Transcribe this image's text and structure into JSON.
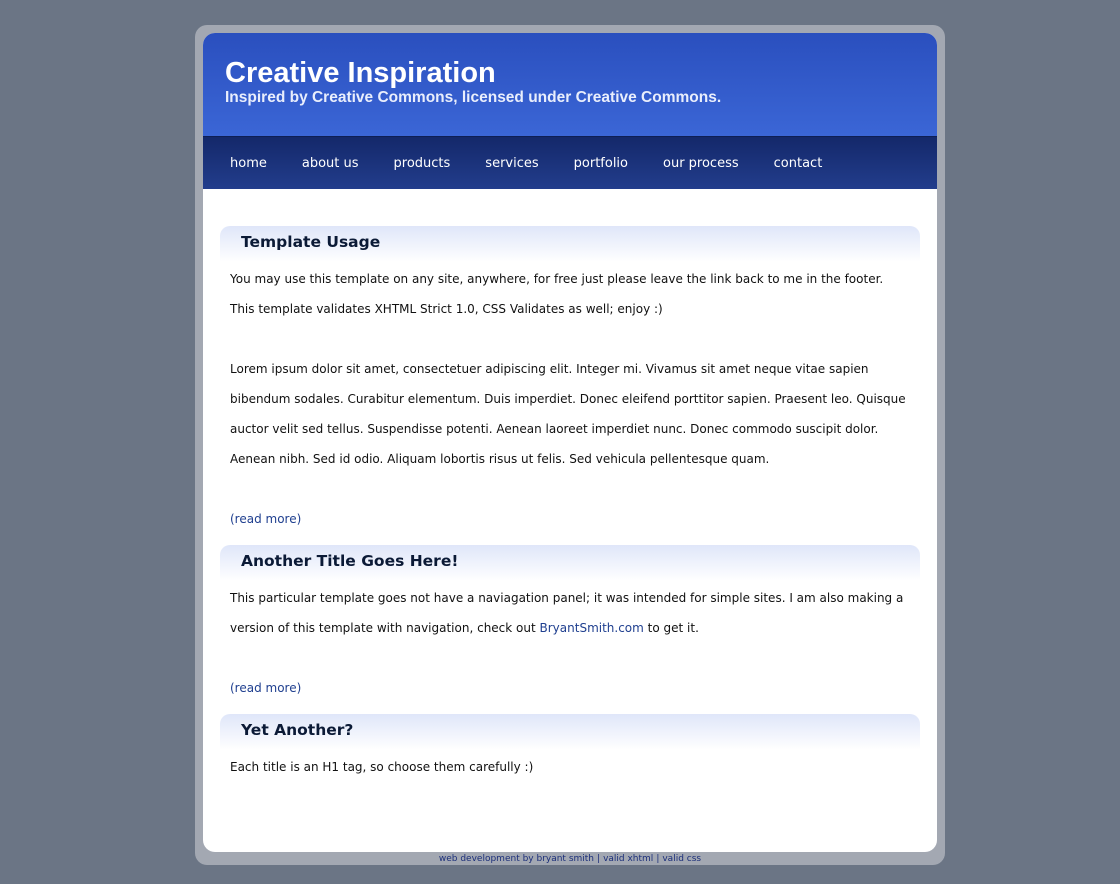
{
  "header": {
    "title": "Creative Inspiration",
    "subtitle": "Inspired by Creative Commons, licensed under Creative Commons."
  },
  "nav": {
    "items": [
      "home",
      "about us",
      "products",
      "services",
      "portfolio",
      "our process",
      "contact"
    ]
  },
  "posts": [
    {
      "title": "Template Usage",
      "paragraphs": [
        "You may use this template on any site, anywhere, for free just please leave the link back to me in the footer. This template validates XHTML Strict 1.0, CSS Validates as well; enjoy :)",
        "Lorem ipsum dolor sit amet, consectetuer adipiscing elit. Integer mi. Vivamus sit amet neque vitae sapien bibendum sodales. Curabitur elementum. Duis imperdiet. Donec eleifend porttitor sapien. Praesent leo. Quisque auctor velit sed tellus. Suspendisse potenti. Aenean laoreet imperdiet nunc. Donec commodo suscipit dolor. Aenean nibh. Sed id odio. Aliquam lobortis risus ut felis. Sed vehicula pellentesque quam."
      ],
      "read_more": "(read more)"
    },
    {
      "title": "Another Title Goes Here!",
      "paragraph_before": "This particular template goes not have a naviagation panel; it was intended for simple sites. I am also making a version of this template with navigation, check out ",
      "link_text": "BryantSmith.com",
      "paragraph_after": " to get it.",
      "read_more": "(read more)"
    },
    {
      "title": "Yet Another?",
      "paragraph": "Each title is an H1 tag, so choose them carefully :)"
    }
  ],
  "footer": {
    "credit": "web development by bryant smith",
    "valid_xhtml": "valid xhtml",
    "valid_css": "valid css",
    "separator": "|"
  },
  "colors": {
    "page_bg": "#6b7585",
    "header_bg": "#2a4fbe",
    "nav_bg": "#14286a",
    "link": "#1f3f8f"
  }
}
